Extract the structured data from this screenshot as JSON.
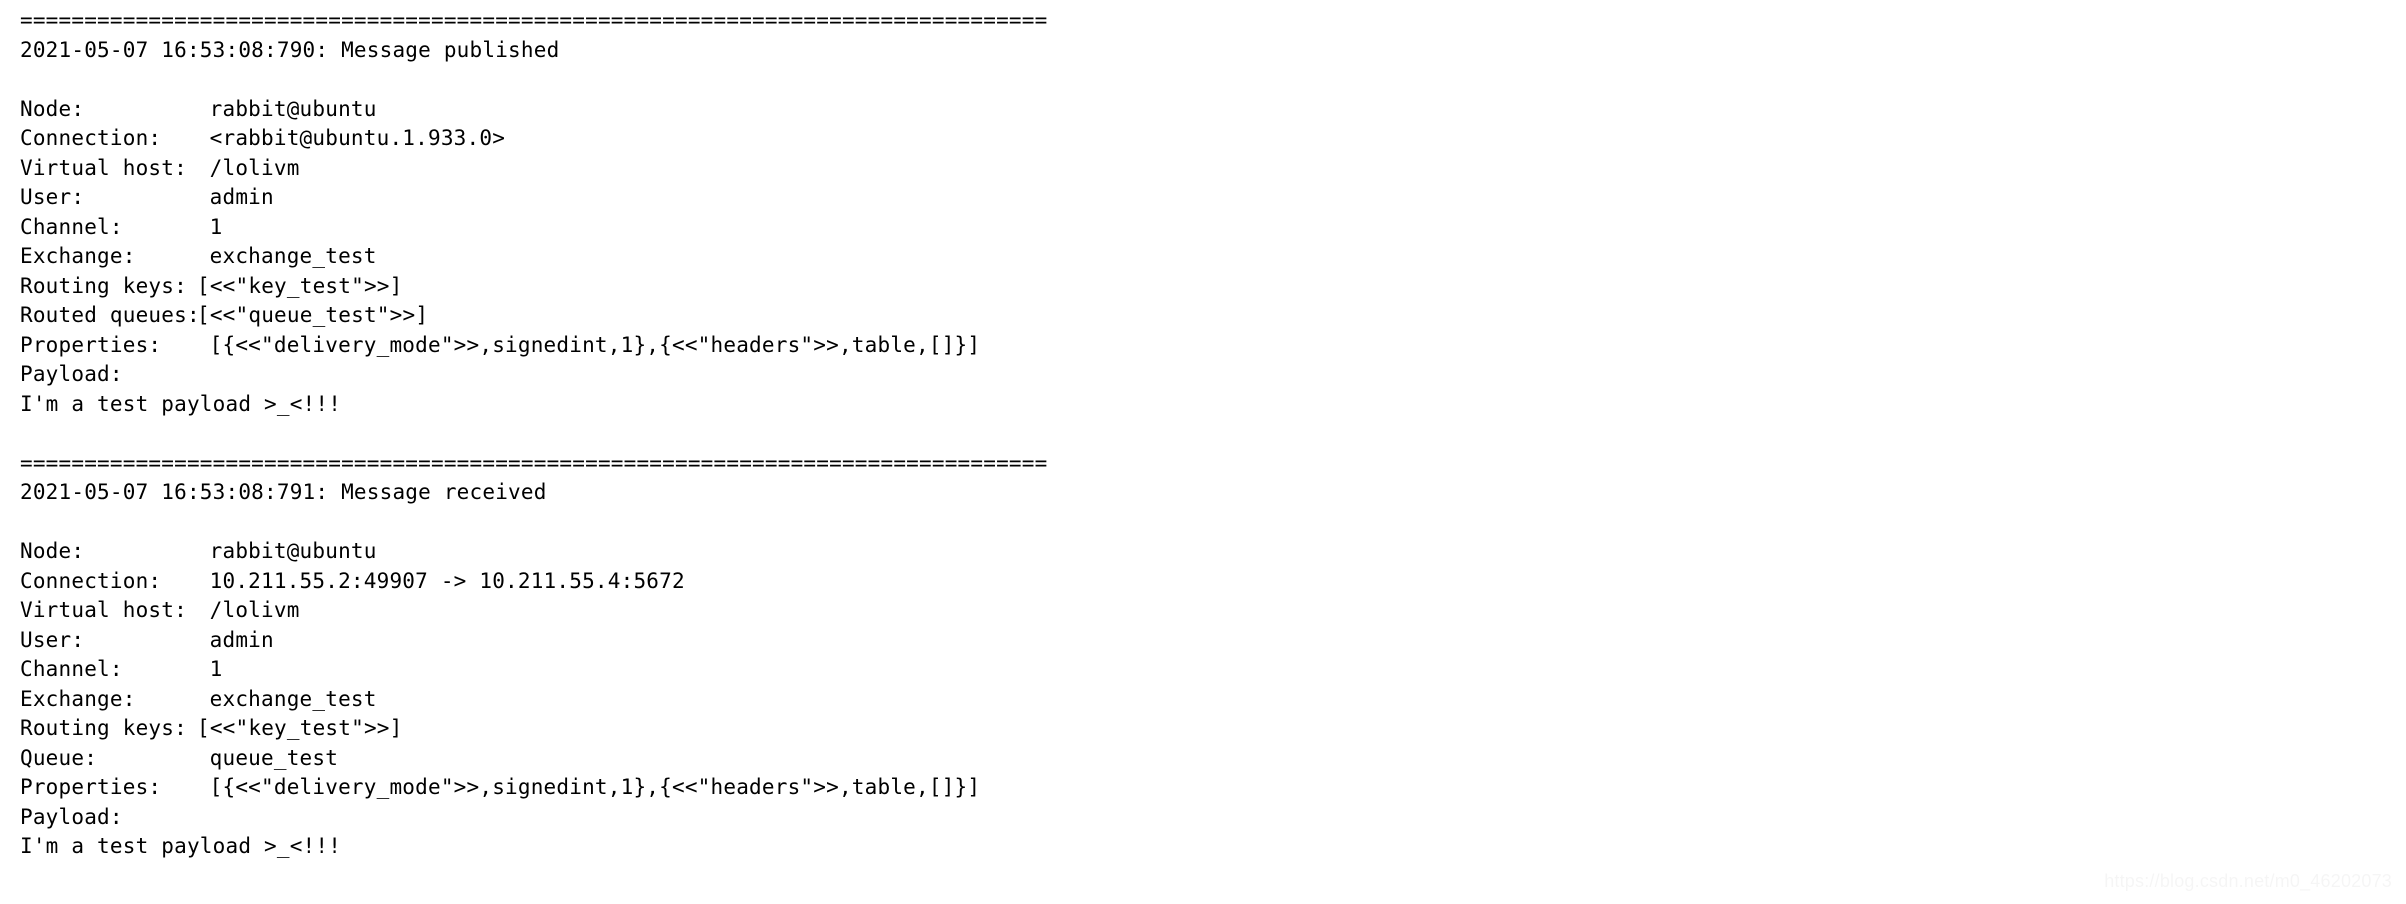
{
  "separator": "================================================================================",
  "watermark": "https://blog.csdn.net/m0_46202073",
  "entries": [
    {
      "header": "2021-05-07 16:53:08:790: Message published",
      "fields": [
        {
          "label": "Node:",
          "labelClass": "w15",
          "value": "rabbit@ubuntu"
        },
        {
          "label": "Connection:",
          "labelClass": "w15",
          "value": "<rabbit@ubuntu.1.933.0>"
        },
        {
          "label": "Virtual host:",
          "labelClass": "w15",
          "value": "/lolivm"
        },
        {
          "label": "User:",
          "labelClass": "w15",
          "value": "admin"
        },
        {
          "label": "Channel:",
          "labelClass": "w15",
          "value": "1"
        },
        {
          "label": "Exchange:",
          "labelClass": "w15",
          "value": "exchange_test"
        },
        {
          "label": "Routing keys:",
          "labelClass": "w14",
          "value": "[<<\"key_test\">>]"
        },
        {
          "label": "Routed queues:",
          "labelClass": "w14",
          "value": "[<<\"queue_test\">>]"
        },
        {
          "label": "Properties:",
          "labelClass": "w15",
          "value": "[{<<\"delivery_mode\">>,signedint,1},{<<\"headers\">>,table,[]}]"
        },
        {
          "label": "Payload:",
          "labelClass": "",
          "value": ""
        }
      ],
      "payload": "I'm a test payload >_<!!!"
    },
    {
      "header": "2021-05-07 16:53:08:791: Message received",
      "fields": [
        {
          "label": "Node:",
          "labelClass": "w15",
          "value": "rabbit@ubuntu"
        },
        {
          "label": "Connection:",
          "labelClass": "w15",
          "value": "10.211.55.2:49907 -> 10.211.55.4:5672"
        },
        {
          "label": "Virtual host:",
          "labelClass": "w15",
          "value": "/lolivm"
        },
        {
          "label": "User:",
          "labelClass": "w15",
          "value": "admin"
        },
        {
          "label": "Channel:",
          "labelClass": "w15",
          "value": "1"
        },
        {
          "label": "Exchange:",
          "labelClass": "w15",
          "value": "exchange_test"
        },
        {
          "label": "Routing keys:",
          "labelClass": "w14",
          "value": "[<<\"key_test\">>]"
        },
        {
          "label": "Queue:",
          "labelClass": "w15",
          "value": "queue_test"
        },
        {
          "label": "Properties:",
          "labelClass": "w15",
          "value": "[{<<\"delivery_mode\">>,signedint,1},{<<\"headers\">>,table,[]}]"
        },
        {
          "label": "Payload:",
          "labelClass": "",
          "value": ""
        }
      ],
      "payload": "I'm a test payload >_<!!!"
    }
  ]
}
